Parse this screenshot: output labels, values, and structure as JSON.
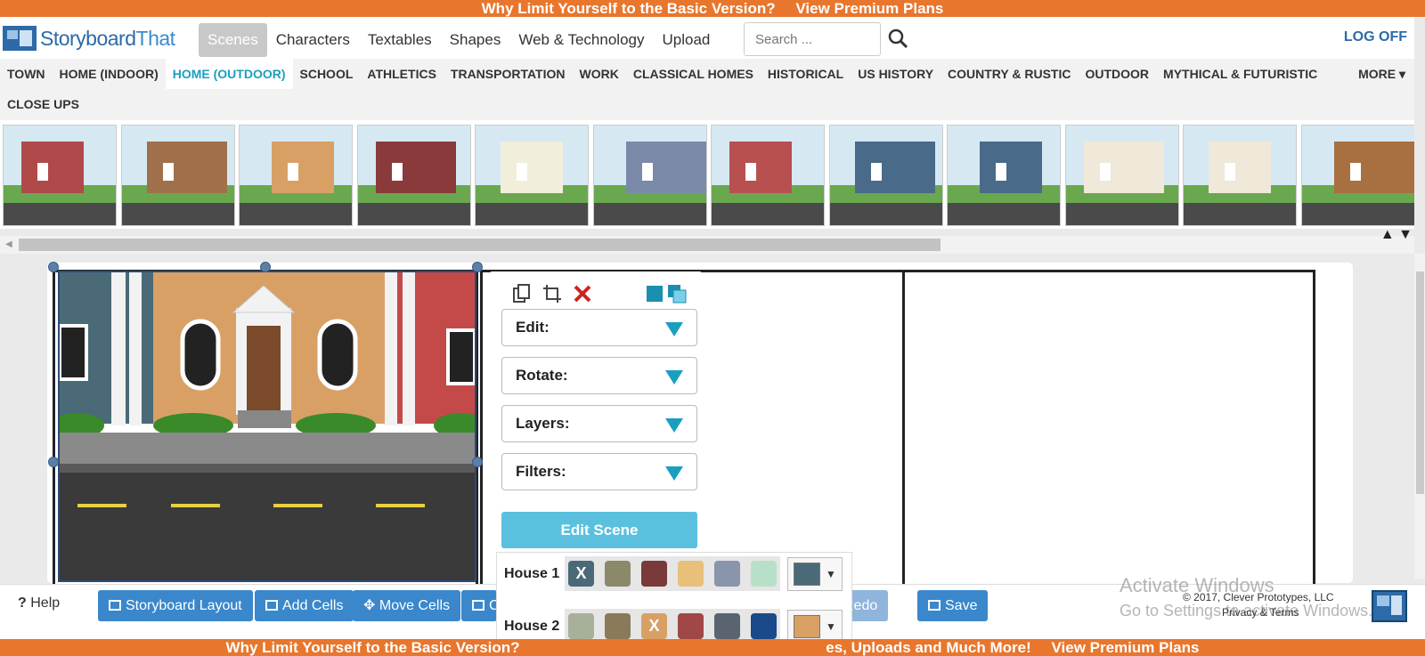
{
  "banner_top": {
    "text": "Why Limit Yourself to the Basic Version?",
    "link": "View Premium Plans"
  },
  "banner_bottom": {
    "text": "Why Limit Yourself to the Basic Version?",
    "middle": "es, Uploads and Much More!",
    "link": "View Premium Plans"
  },
  "logo": {
    "part1": "Storyboard",
    "part2": "That"
  },
  "nav": {
    "tabs": [
      "Scenes",
      "Characters",
      "Textables",
      "Shapes",
      "Web & Technology",
      "Upload"
    ],
    "active": "Scenes",
    "search_placeholder": "Search ...",
    "logoff": "LOG OFF"
  },
  "categories": {
    "items": [
      "TOWN",
      "HOME (INDOOR)",
      "HOME (OUTDOOR)",
      "SCHOOL",
      "ATHLETICS",
      "TRANSPORTATION",
      "WORK",
      "CLASSICAL HOMES",
      "HISTORICAL",
      "US HISTORY",
      "COUNTRY & RUSTIC",
      "OUTDOOR",
      "MYTHICAL & FUTURISTIC",
      "CLOSE UPS"
    ],
    "active": "HOME (OUTDOOR)",
    "more": "MORE"
  },
  "thumbnails": [
    {
      "house": "#b04a4a"
    },
    {
      "house": "#a0704a"
    },
    {
      "house": "#d9a066"
    },
    {
      "house": "#8a3a3a"
    },
    {
      "house": "#f2eedc"
    },
    {
      "house": "#7a8aa8"
    },
    {
      "house": "#b85050"
    },
    {
      "house": "#4a6a8a"
    },
    {
      "house": "#4a6a8a"
    },
    {
      "house": "#f0e8d8"
    },
    {
      "house": "#f0e8d8"
    },
    {
      "house": "#a87040"
    }
  ],
  "tools": {
    "edit": "Edit:",
    "rotate": "Rotate:",
    "layers": "Layers:",
    "filters": "Filters:",
    "edit_scene": "Edit Scene"
  },
  "color_panel": {
    "rows": [
      {
        "label": "House 1",
        "swatches": [
          "#4a6a78",
          "#8a8a6a",
          "#7a3a3a",
          "#e8c07a",
          "#8a94aa",
          "#b8e0c8"
        ],
        "selected_index": 0,
        "selected_mark": "X",
        "current": "#4a6a78"
      },
      {
        "label": "House 2",
        "swatches": [
          "#a8b09a",
          "#8a7a5a",
          "#d9a066",
          "#a04848",
          "#5a6470",
          "#1a4a8a"
        ],
        "selected_index": 2,
        "selected_mark": "X",
        "current": "#d9a066"
      }
    ]
  },
  "bottom": {
    "help": "Help",
    "buttons": [
      "Storyboard Layout",
      "Add Cells",
      "Move Cells",
      "C"
    ],
    "redo": "Redo",
    "save": "Save",
    "copyright": "© 2017, Clever Prototypes, LLC",
    "privacy": "Privacy & Terms",
    "activate_title": "Activate Windows",
    "activate_sub": "Go to Settings to activate Windows."
  }
}
